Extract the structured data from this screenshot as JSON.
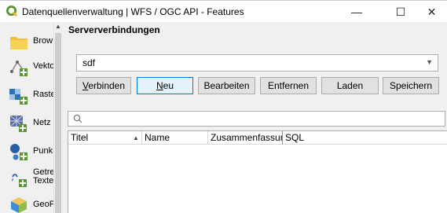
{
  "window": {
    "title": "Datenquellenverwaltung | WFS / OGC API - Features",
    "minimize_glyph": "—",
    "maximize_glyph": "☐",
    "close_glyph": "✕",
    "icon": "qgis-logo-icon"
  },
  "sidebar": {
    "items": [
      {
        "label": "Brow",
        "icon": "folder-icon"
      },
      {
        "label": "Vekto",
        "icon": "vector-layer-icon"
      },
      {
        "label": "Raste",
        "icon": "raster-layer-icon"
      },
      {
        "label": "Netz",
        "icon": "mesh-layer-icon"
      },
      {
        "label": "Punk",
        "icon": "point-cloud-icon"
      },
      {
        "label": "Getre",
        "label2": "Texte",
        "icon": "delimited-text-icon"
      },
      {
        "label": "GeoP",
        "icon": "geopackage-icon"
      }
    ]
  },
  "main": {
    "section_title": "Serververbindungen",
    "connection_combo": {
      "value": "sdf"
    },
    "buttons": {
      "connect": "Verbinden",
      "new": "Neu",
      "edit": "Bearbeiten",
      "remove": "Entfernen",
      "load": "Laden",
      "save": "Speichern"
    },
    "search": {
      "placeholder": ""
    },
    "table": {
      "columns": [
        "Titel",
        "Name",
        "Zusammenfassung",
        "SQL"
      ],
      "sort_column": "Titel",
      "rows": []
    }
  },
  "colors": {
    "accent": "#0078d7",
    "qgis_green": "#589632",
    "qgis_yellow": "#f0b32e"
  }
}
